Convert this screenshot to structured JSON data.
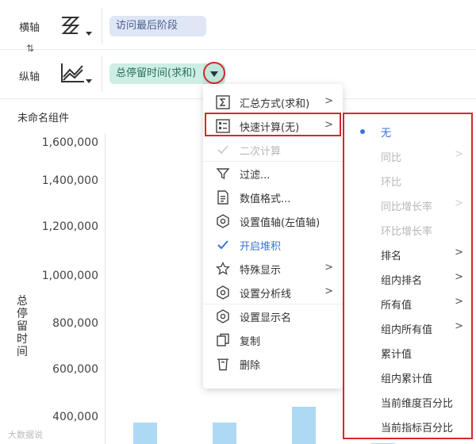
{
  "axis_config": {
    "x_axis": {
      "label": "横轴",
      "field": "访问最后阶段",
      "icon": "bar-chart-icon"
    },
    "swap_icon": "swap-icon",
    "y_axis": {
      "label": "纵轴",
      "field": "总停留时间(求和)",
      "icon": "line-chart-icon"
    }
  },
  "chart": {
    "title": "未命名组件",
    "y_axis_title": "总停留时间",
    "y_ticks": [
      "1,600,000",
      "1,400,000",
      "1,200,000",
      "1,000,000",
      "800,000",
      "600,000",
      "400,000"
    ],
    "bar_color": "#aed9f5"
  },
  "chart_data": {
    "type": "bar",
    "ylabel": "总停留时间",
    "y_ticks": [
      400000,
      600000,
      800000,
      1000000,
      1200000,
      1400000,
      1600000
    ],
    "values": [
      380000,
      380000,
      450000,
      290000
    ]
  },
  "context_menu": {
    "items": [
      {
        "label": "汇总方式(求和)",
        "icon": "sigma-icon",
        "arrow": ">",
        "state": "normal"
      },
      {
        "label": "快速计算(无)",
        "icon": "grid-list-icon",
        "arrow": ">",
        "state": "highlighted"
      },
      {
        "label": "二次计算",
        "icon": "check-icon",
        "arrow": "",
        "state": "disabled"
      },
      {
        "label": "过滤...",
        "icon": "filter-icon",
        "arrow": "",
        "state": "normal"
      },
      {
        "label": "数值格式...",
        "icon": "number-format-icon",
        "arrow": "",
        "state": "normal"
      },
      {
        "label": "设置值轴(左值轴)",
        "icon": "hexagon-settings-icon",
        "arrow": "",
        "state": "normal"
      },
      {
        "label": "开启堆积",
        "icon": "check-icon",
        "arrow": "",
        "state": "checked"
      },
      {
        "label": "特殊显示",
        "icon": "star-icon",
        "arrow": ">",
        "state": "normal"
      },
      {
        "label": "设置分析线",
        "icon": "hexagon-settings-icon",
        "arrow": ">",
        "state": "normal"
      },
      {
        "label": "设置显示名",
        "icon": "hexagon-settings-icon",
        "arrow": "",
        "state": "normal"
      },
      {
        "label": "复制",
        "icon": "copy-icon",
        "arrow": "",
        "state": "normal"
      },
      {
        "label": "删除",
        "icon": "trash-icon",
        "arrow": "",
        "state": "normal"
      }
    ]
  },
  "submenu": {
    "items": [
      {
        "label": "无",
        "arrow": "",
        "state": "selected"
      },
      {
        "label": "同比",
        "arrow": ">",
        "state": "disabled"
      },
      {
        "label": "环比",
        "arrow": "",
        "state": "disabled"
      },
      {
        "label": "同比增长率",
        "arrow": ">",
        "state": "disabled"
      },
      {
        "label": "环比增长率",
        "arrow": "",
        "state": "disabled"
      },
      {
        "label": "排名",
        "arrow": ">",
        "state": "normal"
      },
      {
        "label": "组内排名",
        "arrow": ">",
        "state": "normal"
      },
      {
        "label": "所有值",
        "arrow": ">",
        "state": "normal"
      },
      {
        "label": "组内所有值",
        "arrow": ">",
        "state": "normal"
      },
      {
        "label": "累计值",
        "arrow": "",
        "state": "normal"
      },
      {
        "label": "组内累计值",
        "arrow": "",
        "state": "normal"
      },
      {
        "label": "当前维度百分比",
        "arrow": "",
        "state": "normal"
      },
      {
        "label": "当前指标百分比",
        "arrow": "",
        "state": "normal"
      }
    ]
  },
  "watermark": "大数据说"
}
